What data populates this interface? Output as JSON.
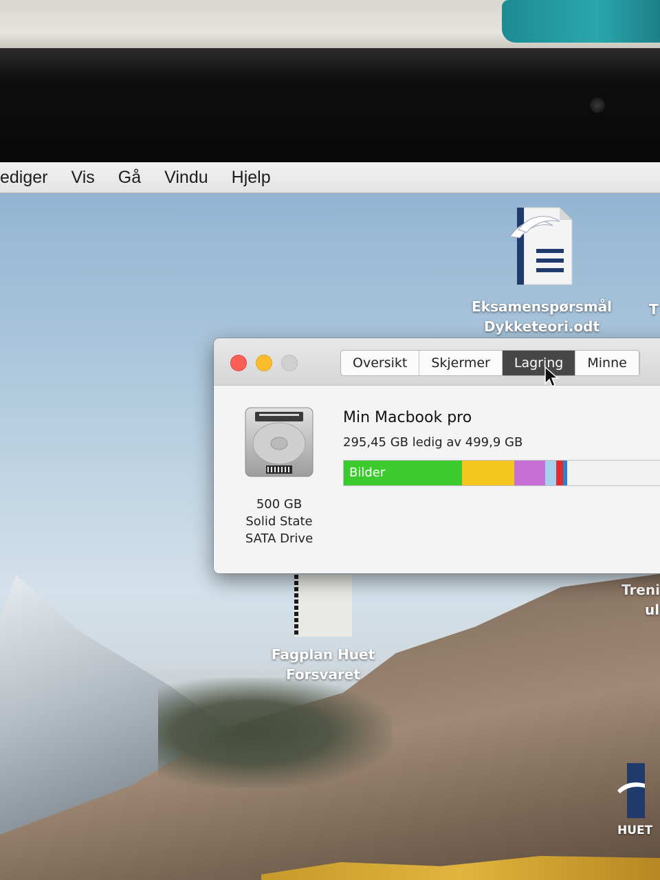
{
  "menubar": {
    "items": [
      "ediger",
      "Vis",
      "Gå",
      "Vindu",
      "Hjelp"
    ]
  },
  "desktop": {
    "icons": [
      {
        "line1": "Eksamenspørsmål",
        "line2": "Dykketeori.odt",
        "icon": "odt-document-icon"
      },
      {
        "line1": "Fagplan Huet",
        "line2": "Forsvaret",
        "icon": "document-thumbnail-icon"
      }
    ],
    "edge_labels": [
      "T",
      "Treni",
      "ul",
      "HUET"
    ]
  },
  "window": {
    "tabs": [
      {
        "label": "Oversikt",
        "active": false
      },
      {
        "label": "Skjermer",
        "active": false
      },
      {
        "label": "Lagring",
        "active": true
      },
      {
        "label": "Minne",
        "active": false
      }
    ],
    "drive": {
      "icon": "hard-drive-icon",
      "size": "500 GB",
      "type_line1": "Solid State",
      "type_line2": "SATA Drive",
      "name": "Min Macbook pro",
      "free_text": "295,45 GB ledig av 499,9 GB"
    },
    "storage_bar": {
      "total_gb": 499.9,
      "free_gb": 295.45,
      "segments": [
        {
          "label": "Bilder",
          "color": "#3ccb2e",
          "fraction": 0.33
        },
        {
          "label": "",
          "color": "#f2c71f",
          "fraction": 0.147
        },
        {
          "label": "",
          "color": "#c86fd6",
          "fraction": 0.087
        },
        {
          "label": "",
          "color": "#a7d0ec",
          "fraction": 0.031
        },
        {
          "label": "",
          "color": "#e22c2c",
          "fraction": 0.019
        },
        {
          "label": "",
          "color": "#2f7fd6",
          "fraction": 0.012
        },
        {
          "label": "",
          "color": "#f2f2f2",
          "fraction": 0.374
        }
      ]
    }
  }
}
